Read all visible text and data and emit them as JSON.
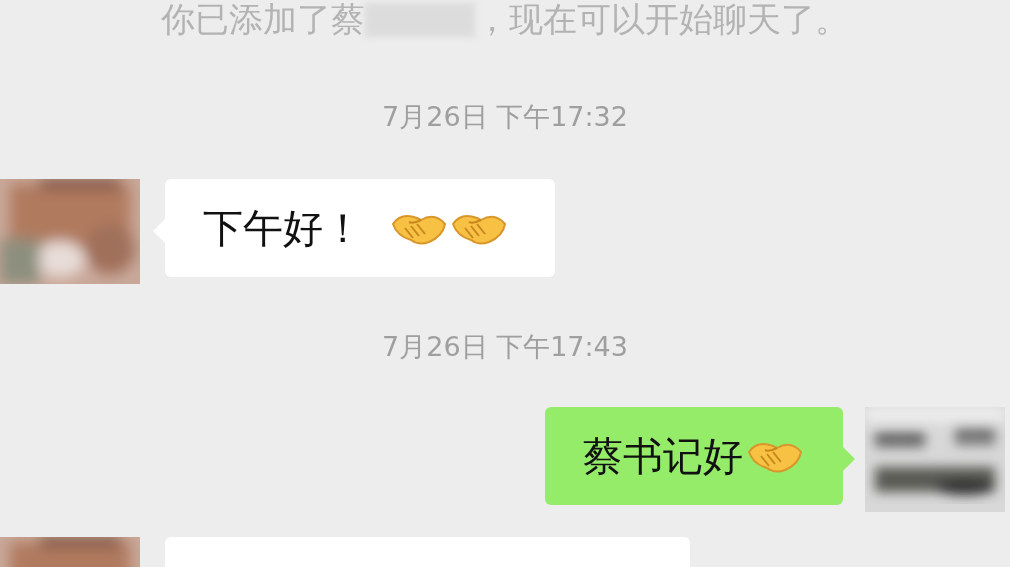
{
  "system_notice": {
    "parts": [
      "你已添加了蔡",
      "，现在可以开始聊天了。"
    ],
    "redacted": true
  },
  "messages": [
    {
      "kind": "timestamp",
      "text": "7月26日 下午17:32"
    },
    {
      "kind": "incoming",
      "text": "下午好！",
      "icons": [
        {
          "kind": "handshake"
        },
        {
          "kind": "handshake"
        }
      ]
    },
    {
      "kind": "timestamp",
      "text": "7月26日 下午17:43"
    },
    {
      "kind": "outgoing",
      "text": "蔡书记好",
      "icons": [
        {
          "kind": "handshake"
        }
      ]
    },
    {
      "kind": "incoming"
    }
  ]
}
